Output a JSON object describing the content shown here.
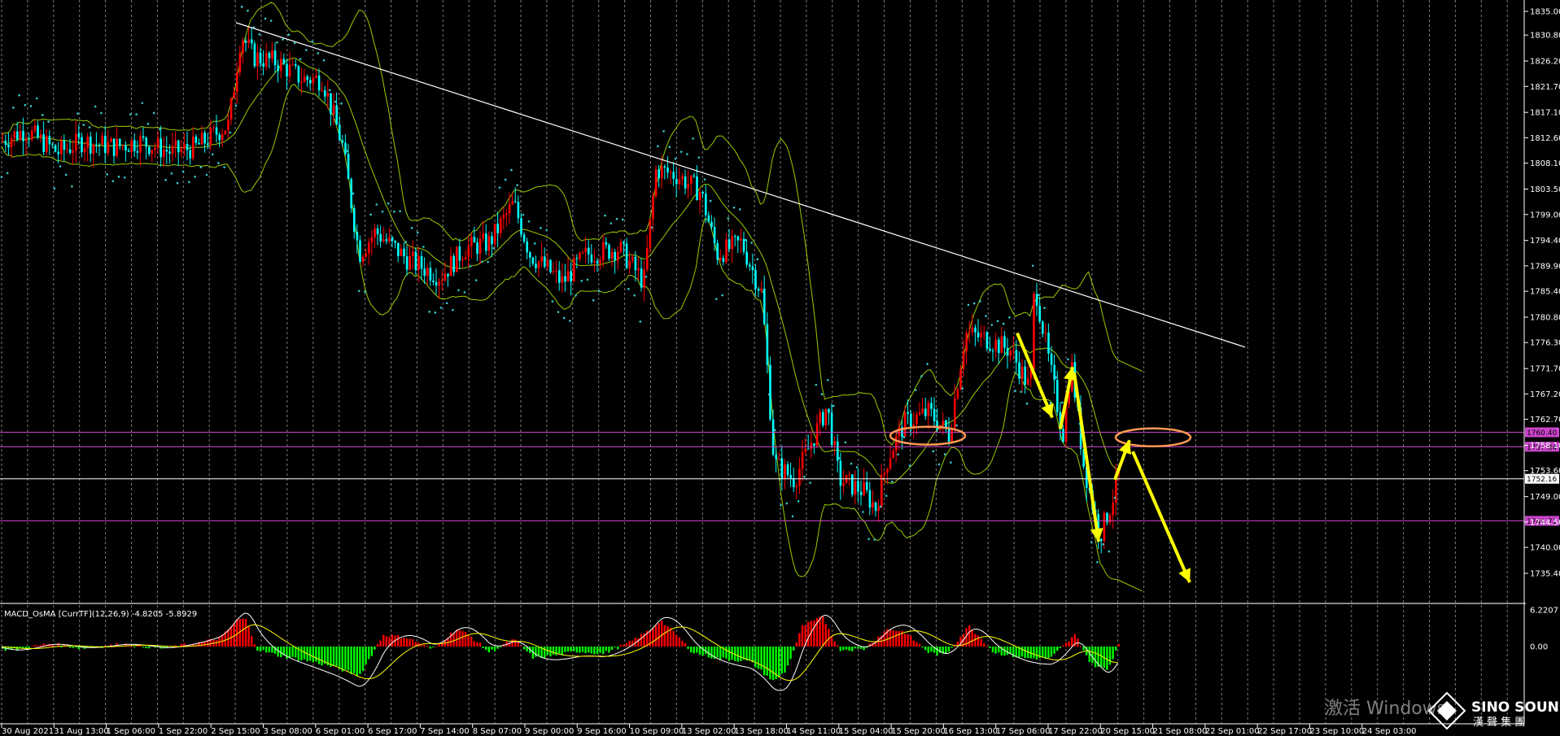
{
  "chart_data": [
    {
      "type": "candlestick",
      "title": "",
      "ylim": [
        1735.4,
        1835.0
      ],
      "y_ticks": [
        "1835.00",
        "1830.80",
        "1826.20",
        "1821.70",
        "1817.10",
        "1812.60",
        "1808.10",
        "1803.50",
        "1799.00",
        "1794.40",
        "1789.90",
        "1785.40",
        "1780.80",
        "1776.30",
        "1771.70",
        "1767.20",
        "1762.70",
        "1758.10",
        "1753.60",
        "1749.00",
        "1744.50",
        "1740.00",
        "1735.40"
      ],
      "x_ticks": [
        "30 Aug 2021",
        "31 Aug 13:00",
        "1 Sep 06:00",
        "1 Sep 22:00",
        "2 Sep 15:00",
        "3 Sep 08:00",
        "6 Sep 01:00",
        "6 Sep 17:00",
        "7 Sep 14:00",
        "8 Sep 07:00",
        "9 Sep 00:00",
        "9 Sep 16:00",
        "10 Sep 09:00",
        "13 Sep 02:00",
        "13 Sep 18:00",
        "14 Sep 11:00",
        "15 Sep 04:00",
        "15 Sep 20:00",
        "16 Sep 13:00",
        "17 Sep 06:00",
        "17 Sep 22:00",
        "20 Sep 15:00",
        "21 Sep 08:00",
        "22 Sep 01:00",
        "22 Sep 17:00",
        "23 Sep 10:00",
        "24 Sep 03:00"
      ],
      "price_path": [
        [
          0,
          1812
        ],
        [
          30,
          1814
        ],
        [
          70,
          1810
        ],
        [
          100,
          1812
        ],
        [
          140,
          1811
        ],
        [
          170,
          1812
        ],
        [
          210,
          1810
        ],
        [
          240,
          1811
        ],
        [
          280,
          1815
        ],
        [
          295,
          1831
        ],
        [
          310,
          1827
        ],
        [
          340,
          1826
        ],
        [
          370,
          1823
        ],
        [
          395,
          1823
        ],
        [
          420,
          1811
        ],
        [
          440,
          1792
        ],
        [
          460,
          1796
        ],
        [
          500,
          1791
        ],
        [
          540,
          1788
        ],
        [
          570,
          1793
        ],
        [
          600,
          1794
        ],
        [
          630,
          1801
        ],
        [
          650,
          1792
        ],
        [
          690,
          1787
        ],
        [
          720,
          1792
        ],
        [
          760,
          1793
        ],
        [
          790,
          1787
        ],
        [
          805,
          1807
        ],
        [
          830,
          1806
        ],
        [
          860,
          1803
        ],
        [
          880,
          1792
        ],
        [
          910,
          1794
        ],
        [
          935,
          1785
        ],
        [
          950,
          1755
        ],
        [
          975,
          1752
        ],
        [
          1000,
          1760
        ],
        [
          1015,
          1765
        ],
        [
          1030,
          1752
        ],
        [
          1060,
          1750
        ],
        [
          1075,
          1747
        ],
        [
          1090,
          1756
        ],
        [
          1110,
          1762
        ],
        [
          1140,
          1764
        ],
        [
          1165,
          1760
        ],
        [
          1185,
          1778
        ],
        [
          1210,
          1777
        ],
        [
          1240,
          1775
        ],
        [
          1265,
          1768
        ],
        [
          1270,
          1787
        ],
        [
          1285,
          1775
        ],
        [
          1305,
          1760
        ],
        [
          1315,
          1773
        ],
        [
          1330,
          1755
        ],
        [
          1350,
          1742
        ],
        [
          1365,
          1748
        ],
        [
          1375,
          1754
        ]
      ],
      "horizontal_lines": [
        {
          "value": 1760.4,
          "label": "1760.40",
          "color": "#cc44cc"
        },
        {
          "value": 1757.84,
          "label": "1757.84",
          "color": "#cc44cc"
        },
        {
          "value": 1752.16,
          "label": "1752.16",
          "color": "#ffffff"
        },
        {
          "value": 1744.71,
          "label": "1744.71",
          "color": "#cc44cc"
        }
      ],
      "trendline": {
        "from": [
          290,
          1833
        ],
        "to": [
          1530,
          1775.5
        ],
        "color": "#ffffff"
      },
      "bollinger": {
        "color": "#99cc00"
      },
      "parabolic_sar": {
        "color": "#33cccc"
      },
      "annotations": {
        "arrow_color": "#ffff00",
        "ellipse_color": "#ff9955",
        "ellipses": [
          [
            1140,
            1759.8
          ],
          [
            1417,
            1759.5
          ]
        ],
        "arrows": [
          [
            [
              1250,
              1778
            ],
            [
              1293,
              1763
            ]
          ],
          [
            [
              1303,
              1761
            ],
            [
              1318,
              1772
            ]
          ],
          [
            [
              1320,
              1771
            ],
            [
              1350,
              1741
            ]
          ],
          [
            [
              1370,
              1752
            ],
            [
              1388,
              1759
            ]
          ],
          [
            [
              1392,
              1757
            ],
            [
              1462,
              1733.8
            ]
          ]
        ]
      },
      "candle_up_color": "#ff0000",
      "candle_down_color": "#00ffff"
    },
    {
      "type": "bar",
      "indicator": "MACD_OsMA",
      "label": "MACD_OsMA [CurrTF](12,26,9) -4.8205 -5.8929",
      "y_ticks": [
        "6.2207",
        "0.00"
      ],
      "ylim": [
        -12,
        6.2207
      ],
      "bars": [
        [
          20,
          -0.5
        ],
        [
          60,
          0.5
        ],
        [
          100,
          -0.3
        ],
        [
          150,
          0.4
        ],
        [
          200,
          -0.3
        ],
        [
          250,
          0.8
        ],
        [
          270,
          1.5
        ],
        [
          290,
          4.5
        ],
        [
          300,
          4.8
        ],
        [
          315,
          -0.5
        ],
        [
          340,
          -1.5
        ],
        [
          380,
          -2.5
        ],
        [
          410,
          -3.5
        ],
        [
          440,
          -5
        ],
        [
          470,
          2
        ],
        [
          500,
          1.5
        ],
        [
          530,
          -0.5
        ],
        [
          560,
          3
        ],
        [
          575,
          2
        ],
        [
          600,
          -1
        ],
        [
          630,
          1.2
        ],
        [
          655,
          -2
        ],
        [
          680,
          -1.5
        ],
        [
          710,
          -0.8
        ],
        [
          740,
          -1.2
        ],
        [
          770,
          0.5
        ],
        [
          800,
          3
        ],
        [
          810,
          4.5
        ],
        [
          830,
          2
        ],
        [
          850,
          -1
        ],
        [
          880,
          -2
        ],
        [
          920,
          -2.5
        ],
        [
          950,
          -6
        ],
        [
          965,
          -4
        ],
        [
          985,
          3.5
        ],
        [
          1010,
          5
        ],
        [
          1030,
          -0.5
        ],
        [
          1060,
          -0.5
        ],
        [
          1090,
          3
        ],
        [
          1110,
          2.5
        ],
        [
          1140,
          -1
        ],
        [
          1160,
          -1.5
        ],
        [
          1190,
          3.5
        ],
        [
          1220,
          -1
        ],
        [
          1260,
          -2
        ],
        [
          1290,
          -2
        ],
        [
          1320,
          2
        ],
        [
          1340,
          -3
        ],
        [
          1360,
          -4
        ],
        [
          1375,
          1
        ]
      ],
      "macd_line_color": "#ffffff",
      "signal_line_color": "#ffff00",
      "up_bar_color": "#ff0000",
      "down_bar_color": "#00ff00"
    }
  ],
  "watermark": {
    "line1": "激活 Windows"
  },
  "logo": {
    "name": "SINO SOUND",
    "sub": "漢 聲 集 團"
  },
  "colors": {
    "background": "#000000",
    "grid": "#ffffff"
  }
}
